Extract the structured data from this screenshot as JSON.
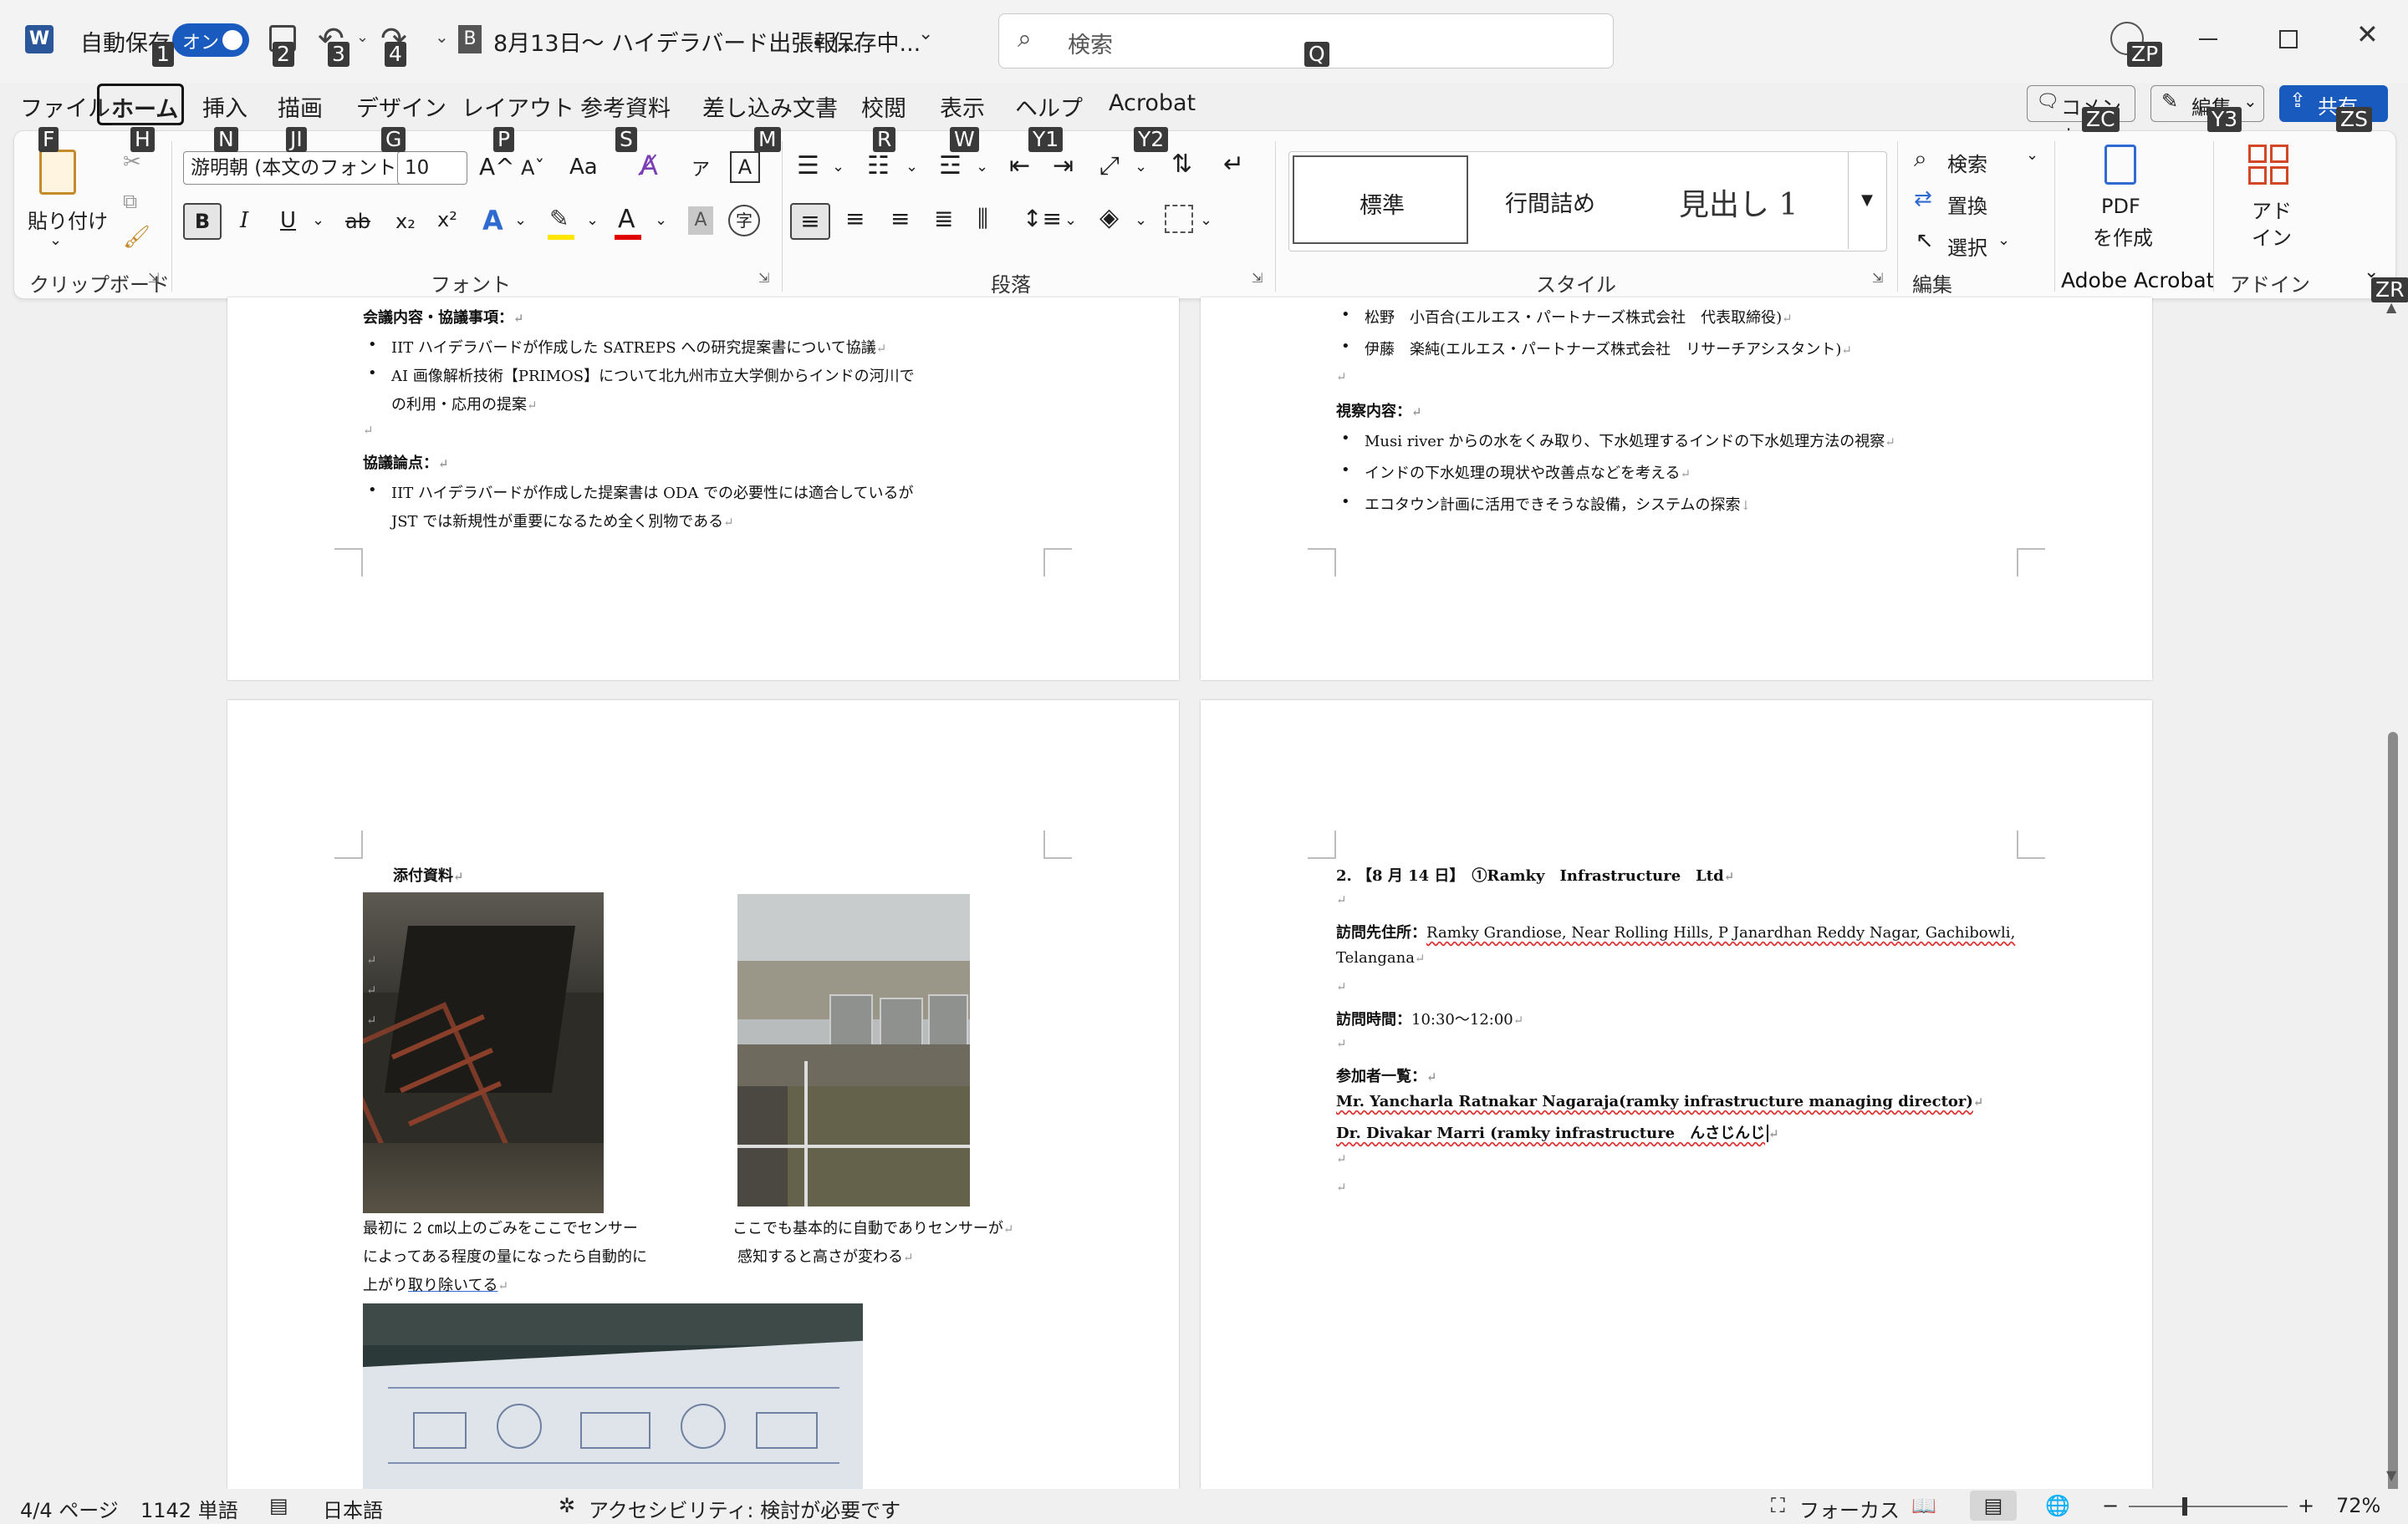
{
  "titlebar": {
    "autosave_label": "自動保存",
    "autosave_state": "オン",
    "doc_title": "8月13日～ ハイデラバード出張報…",
    "save_status": "• 保存中...",
    "search_placeholder": "検索",
    "keytips": {
      "autosave": "1",
      "save": "2",
      "undo": "3",
      "redo": "4",
      "search": "Q",
      "account": "ZP"
    }
  },
  "tabs": [
    {
      "label": "ファイル",
      "key": "F"
    },
    {
      "label": "ホーム",
      "key": "H"
    },
    {
      "label": "挿入",
      "key": "N"
    },
    {
      "label": "描画",
      "key": "JI"
    },
    {
      "label": "デザイン",
      "key": "G"
    },
    {
      "label": "レイアウト",
      "key": "P"
    },
    {
      "label": "参考資料",
      "key": "S"
    },
    {
      "label": "差し込み文書",
      "key": "M"
    },
    {
      "label": "校閲",
      "key": "R"
    },
    {
      "label": "表示",
      "key": "W"
    },
    {
      "label": "ヘルプ",
      "key": "Y1"
    },
    {
      "label": "Acrobat",
      "key": "Y2"
    }
  ],
  "right_buttons": {
    "comment": "コメント",
    "comment_key": "ZC",
    "edit": "編集",
    "edit_key": "Y3",
    "share": "共有",
    "share_key": "ZS"
  },
  "ribbon": {
    "paste": "貼り付け",
    "clipboard": "クリップボード",
    "font_name": "游明朝 (本文のフォント -",
    "font_size": "10",
    "font_group": "フォント",
    "paragraph_group": "段落",
    "styles": [
      "標準",
      "行間詰め",
      "見出し 1"
    ],
    "style_group": "スタイル",
    "find": "検索",
    "replace": "置換",
    "select": "選択",
    "edit_group": "編集",
    "pdf_line1": "PDF",
    "pdf_line2": "を作成",
    "acrobat_group": "Adobe Acrobat",
    "addin_line1": "アド",
    "addin_line2": "イン",
    "addin_group": "アドイン",
    "collapse_key": "ZR",
    "glyphs": {
      "aa": "Aa",
      "bold": "B",
      "italic": "I",
      "underline": "U",
      "strike": "ab",
      "sub": "x₂",
      "sup": "x²",
      "font_color": "A",
      "grow": "A^",
      "shrink": "Aˇ",
      "char_border": "A",
      "phonetic": "ア"
    }
  },
  "page1": {
    "heading_content": "会議内容・協議事項：",
    "b1": "IIT ハイデラバードが作成した SATREPS への研究提案書について協議",
    "b2a": "AI 画像解析技術【PRIMOS】について北九州市立大学側からインドの河川で",
    "b2b": "の利用・応用の提案",
    "heading_points": "協議論点：",
    "b3a": "IIT ハイデラバードが作成した提案書は ODA での必要性には適合しているが",
    "b3b": "JST では新規性が重要になるため全く別物である"
  },
  "page2": {
    "p1": "松野　小百合(エルエス・パートナーズ株式会社　代表取締役)",
    "p2": "伊藤　楽純(エルエス・パートナーズ株式会社　リサーチアシスタント)",
    "heading": "視察内容：",
    "b1": "Musi river からの水をくみ取り、下水処理するインドの下水処理方法の視察",
    "b2": "インドの下水処理の現状や改善点などを考える",
    "b3": "エコタウン計画に活用できそうな設備，システムの探索"
  },
  "page3": {
    "attach": "添付資料",
    "cap1a": "最初に 2 ㎝以上のごみをここでセンサー",
    "cap1b": "によってある程度の量になったら自動的に",
    "cap1c": "上がり",
    "cap1d": "取り除いてる",
    "cap2a": "ここでも基本的に自動でありセンサーが",
    "cap2b": "感知すると高さが変わる"
  },
  "page4": {
    "title": "2. 【8 月 14 日】　①Ramky　Infrastructure　Ltd",
    "addr_label": "訪問先住所：",
    "addr1": "Ramky Grandiose, Near Rolling Hills, P Janardhan Reddy Nagar, Gachibowli,",
    "addr2": "Telangana",
    "time_label": "訪問時間：",
    "time": "10:30～12:00",
    "attend_label": "参加者一覧：",
    "a1": "Mr. Yancharla Ratnakar Nagaraja(ramky infrastructure managing director)",
    "a2": "Dr. Divakar Marri (ramky infrastructure　んさじんじ"
  },
  "status": {
    "page": "4/4 ページ",
    "words": "1142 単語",
    "lang": "日本語",
    "accessibility": "アクセシビリティ: 検討が必要です",
    "focus": "フォーカス",
    "zoom": "72%"
  },
  "colors": {
    "accent": "#185abd",
    "word_blue": "#2b579a",
    "highlight": "#ffe600",
    "font_red": "#e00000"
  }
}
